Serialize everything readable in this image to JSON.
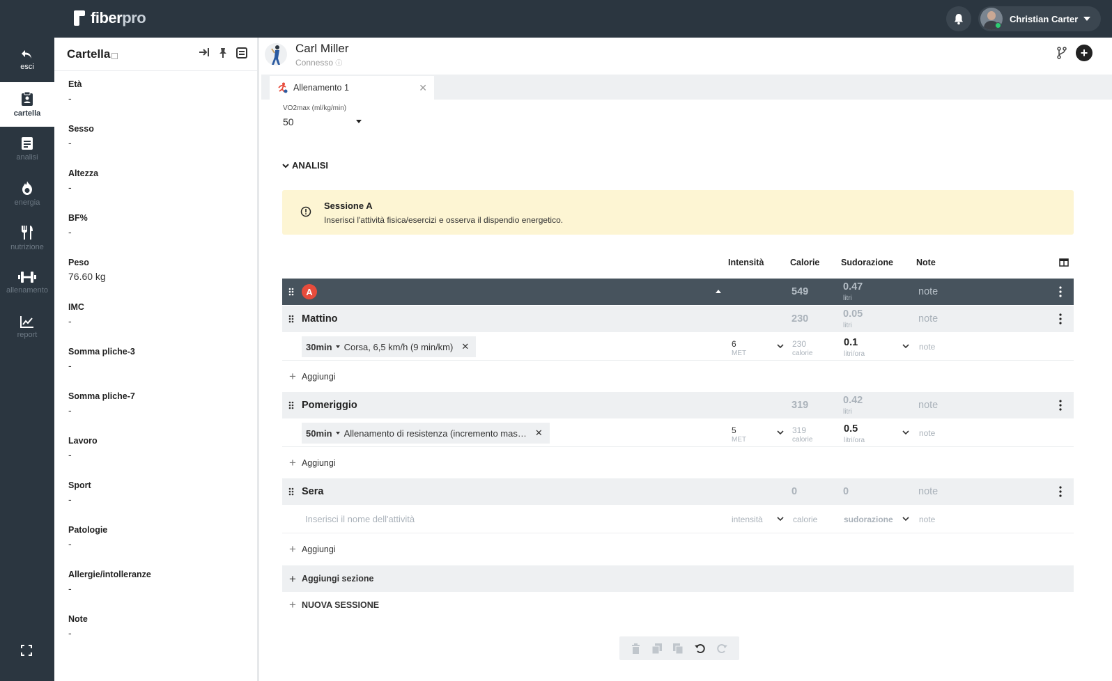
{
  "app": {
    "logo_main": "fiber",
    "logo_sub": "pro",
    "user_name": "Christian Carter"
  },
  "nav": [
    {
      "label": "esci",
      "icon": "undo-arrow-icon"
    },
    {
      "label": "cartella",
      "icon": "clipboard-icon"
    },
    {
      "label": "analisi",
      "icon": "document-icon"
    },
    {
      "label": "energia",
      "icon": "flame-icon"
    },
    {
      "label": "nutrizione",
      "icon": "fork-knife-icon"
    },
    {
      "label": "allenamento",
      "icon": "dumbbell-icon"
    },
    {
      "label": "report",
      "icon": "line-chart-icon"
    }
  ],
  "panel": {
    "title": "Cartella",
    "fields": [
      {
        "label": "Età",
        "value": "-"
      },
      {
        "label": "Sesso",
        "value": "-"
      },
      {
        "label": "Altezza",
        "value": "-"
      },
      {
        "label": "BF%",
        "value": "-"
      },
      {
        "label": "Peso",
        "value": "76.60 kg"
      },
      {
        "label": "IMC",
        "value": "-"
      },
      {
        "label": "Somma pliche-3",
        "value": "-"
      },
      {
        "label": "Somma pliche-7",
        "value": "-"
      },
      {
        "label": "Lavoro",
        "value": "-"
      },
      {
        "label": "Sport",
        "value": "-"
      },
      {
        "label": "Patologie",
        "value": "-"
      },
      {
        "label": "Allergie/intolleranze",
        "value": "-"
      },
      {
        "label": "Note",
        "value": "-"
      }
    ]
  },
  "patient": {
    "name": "Carl Miller",
    "status": "Connesso"
  },
  "tab": {
    "label": "Allenamento 1"
  },
  "vo2": {
    "label": "VO2max (ml/kg/min)",
    "value": "50"
  },
  "analisi": {
    "label": "ANALISI"
  },
  "alert": {
    "title": "Sessione A",
    "text": "Inserisci l'attività fisica/esercizi e osserva il dispendio energetico."
  },
  "columns": {
    "intensity": "Intensità",
    "calories": "Calorie",
    "sweat": "Sudorazione",
    "notes": "Note"
  },
  "session": {
    "badge": "A",
    "calories": "549",
    "sweat": "0.47",
    "sweat_unit": "litri",
    "note": "note"
  },
  "groups": [
    {
      "name": "Mattino",
      "calories": "230",
      "sweat": "0.05",
      "sweat_unit": "litri",
      "note": "note",
      "activity": {
        "duration": "30min",
        "name": "Corsa, 6,5 km/h (9 min/km)",
        "met": "6",
        "met_unit": "MET",
        "calories": "230",
        "calories_unit": "calorie",
        "sweat_rate": "0.1",
        "sweat_rate_unit": "litri/ora",
        "note": "note"
      },
      "add_label": "Aggiungi"
    },
    {
      "name": "Pomeriggio",
      "calories": "319",
      "sweat": "0.42",
      "sweat_unit": "litri",
      "note": "note",
      "activity": {
        "duration": "50min",
        "name": "Allenamento di resistenza (incremento mas…",
        "met": "5",
        "met_unit": "MET",
        "calories": "319",
        "calories_unit": "calorie",
        "sweat_rate": "0.5",
        "sweat_rate_unit": "litri/ora",
        "note": "note"
      },
      "add_label": "Aggiungi"
    },
    {
      "name": "Sera",
      "calories": "0",
      "sweat": "0",
      "note": "note",
      "empty_activity": {
        "placeholder": "Inserisci il nome dell'attività",
        "intensity": "intensità",
        "calories": "calorie",
        "sweat": "sudorazione",
        "note": "note"
      },
      "add_label": "Aggiungi"
    }
  ],
  "add_section": "Aggiungi sezione",
  "new_session": "NUOVA SESSIONE",
  "colors": {
    "nav_bg": "#2b3640",
    "session_row": "#47535d",
    "alert_bg": "#fdf5d3",
    "badge": "#e74c3c"
  }
}
